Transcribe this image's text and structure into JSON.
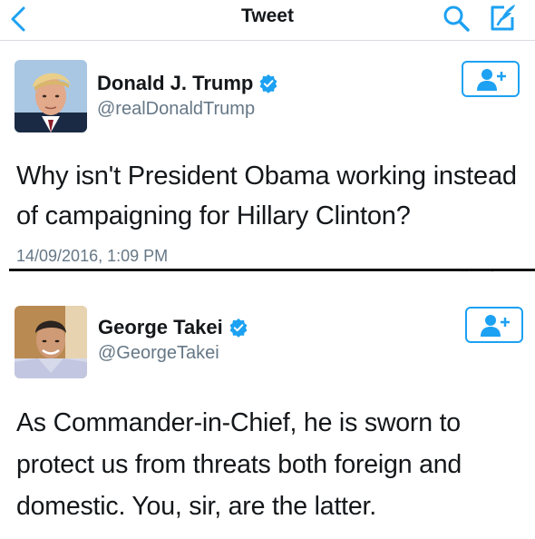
{
  "nav": {
    "title": "Tweet",
    "back_icon": "chevron-left-icon",
    "search_icon": "search-icon",
    "compose_icon": "compose-icon"
  },
  "tweets": [
    {
      "display_name": "Donald J. Trump",
      "handle": "@realDonaldTrump",
      "verified": true,
      "text": "Why isn't President Obama working instead of campaigning for Hillary Clinton?",
      "timestamp": "14/09/2016, 1:09 PM"
    },
    {
      "display_name": "George Takei",
      "handle": "@GeorgeTakei",
      "verified": true,
      "text": "As Commander-in-Chief, he is sworn to protect us from threats both foreign and domestic. You, sir, are the latter."
    }
  ],
  "colors": {
    "accent": "#1da1f2",
    "text": "#14171a",
    "secondary_text": "#657786"
  }
}
